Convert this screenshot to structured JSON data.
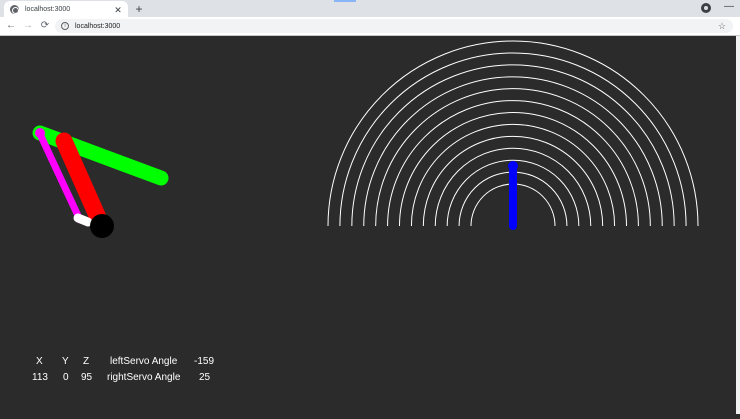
{
  "browser": {
    "tab_title": "localhost:3000",
    "tab_close_glyph": "✕",
    "new_tab_glyph": "+",
    "minimize_glyph": "—",
    "url": "localhost:3000",
    "back_glyph": "←",
    "forward_glyph": "→",
    "reload_glyph": "⟳",
    "info_glyph": "i",
    "star_glyph": "☆",
    "icons": [
      "globe-icon",
      "close-icon",
      "new-tab-icon",
      "profile-icon",
      "minimize-icon",
      "back-icon",
      "forward-icon",
      "reload-icon",
      "info-icon",
      "star-icon"
    ]
  },
  "scene": {
    "background": "#2b2b2b",
    "arm_colors": {
      "green_link": "#00ff00",
      "red_link": "#ff0000",
      "magenta_link": "#ff00ff",
      "end_effector": "#ffffff",
      "base_joint": "#000000"
    },
    "gauge": {
      "arc_color": "#ffffff",
      "arc_count": 13,
      "needle_color": "#0000ff"
    }
  },
  "readout": {
    "x_header": "X",
    "y_header": "Y",
    "z_header": "Z",
    "x_value": "113",
    "y_value": "0",
    "z_value": "95",
    "left_servo_label": "leftServo Angle",
    "left_servo_value": "-159",
    "right_servo_label": "rightServo Angle",
    "right_servo_value": "25"
  }
}
